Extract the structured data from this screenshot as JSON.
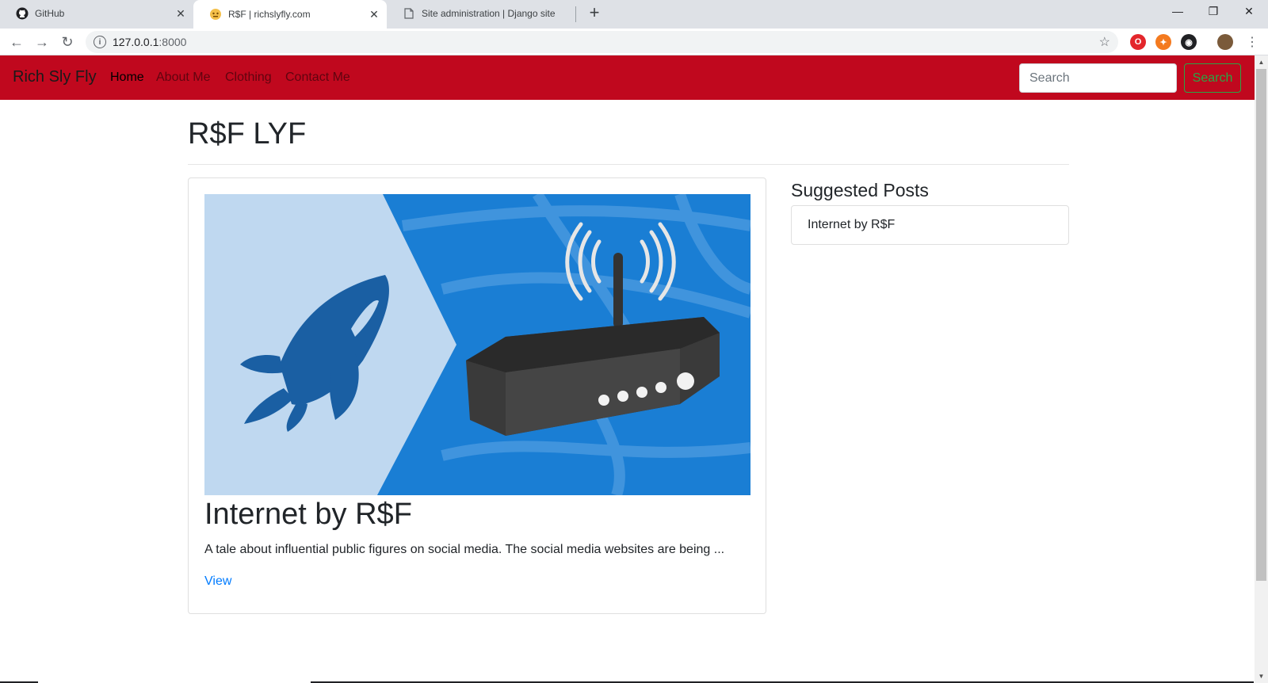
{
  "browser": {
    "tabs": [
      {
        "title": "GitHub",
        "icon": "github-icon"
      },
      {
        "title": "R$F | richslyfly.com",
        "icon": "site-favicon"
      },
      {
        "title": "Site administration | Django site",
        "icon": "document-icon"
      }
    ],
    "url": "127.0.0.1",
    "port": ":8000"
  },
  "nav": {
    "brand": "Rich Sly Fly",
    "links": [
      "Home",
      "About Me",
      "Clothing",
      "Contact Me"
    ],
    "search_placeholder": "Search",
    "search_button": "Search"
  },
  "main": {
    "heading": "R$F LYF",
    "post": {
      "title": "Internet by R$F",
      "excerpt": "A tale about influential public figures on social media. The social media websites are being ...",
      "link": "View",
      "image": "router-rocket-illustration"
    }
  },
  "sidebar": {
    "title": "Suggested Posts",
    "items": [
      "Internet by R$F"
    ]
  },
  "colors": {
    "navbar": "#c0081e",
    "success": "#28a745",
    "link": "#007bff"
  }
}
